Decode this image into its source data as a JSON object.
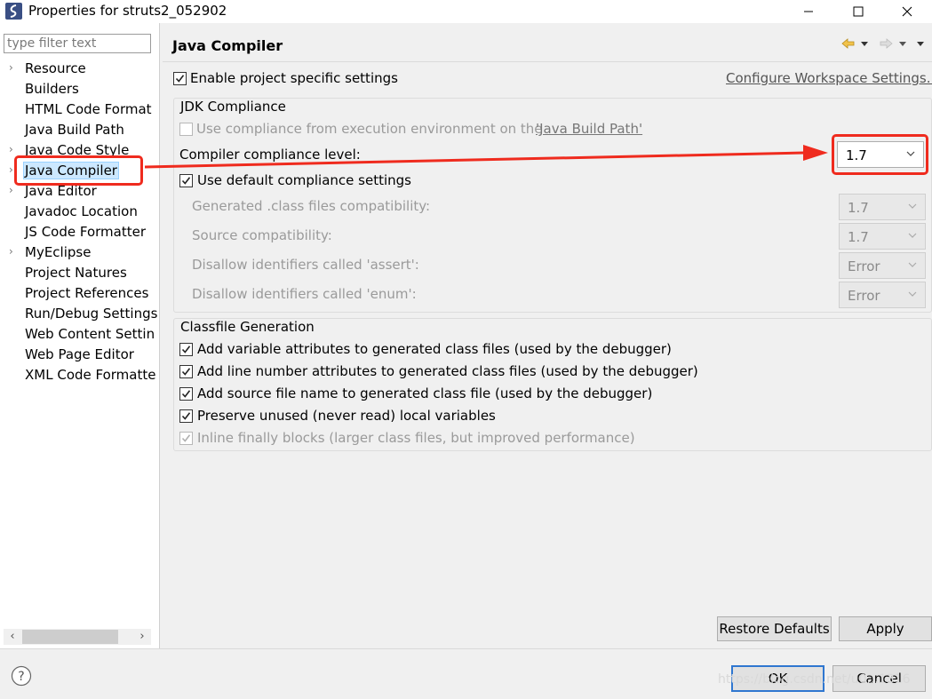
{
  "window": {
    "title": "Properties for struts2_052902"
  },
  "sidebar": {
    "filter_placeholder": "type filter text",
    "items": [
      {
        "label": "Resource",
        "expandable": true
      },
      {
        "label": "Builders",
        "expandable": false
      },
      {
        "label": "HTML Code Format",
        "expandable": false
      },
      {
        "label": "Java Build Path",
        "expandable": false
      },
      {
        "label": "Java Code Style",
        "expandable": true
      },
      {
        "label": "Java Compiler",
        "expandable": true,
        "selected": true
      },
      {
        "label": "Java Editor",
        "expandable": true
      },
      {
        "label": "Javadoc Location",
        "expandable": false
      },
      {
        "label": "JS Code Formatter",
        "expandable": false
      },
      {
        "label": "MyEclipse",
        "expandable": true
      },
      {
        "label": "Project Natures",
        "expandable": false
      },
      {
        "label": "Project References",
        "expandable": false
      },
      {
        "label": "Run/Debug Settings",
        "expandable": false
      },
      {
        "label": "Web Content Settin",
        "expandable": false
      },
      {
        "label": "Web Page Editor",
        "expandable": false
      },
      {
        "label": "XML Code Formatte",
        "expandable": false
      }
    ]
  },
  "main": {
    "title": "Java Compiler",
    "enable_project_settings": {
      "label": "Enable project specific settings",
      "checked": true
    },
    "configure_workspace_link": "Configure Workspace Settings...",
    "jdk": {
      "group_label": "JDK Compliance",
      "use_exec_env": {
        "label": "Use compliance from execution environment on the",
        "checked": false,
        "enabled": false
      },
      "build_path_link": "'Java Build Path'",
      "compliance_level_label": "Compiler compliance level:",
      "compliance_level_value": "1.7",
      "use_default": {
        "label": "Use default compliance settings",
        "checked": true
      },
      "generated_label": "Generated .class files compatibility:",
      "generated_value": "1.7",
      "source_label": "Source compatibility:",
      "source_value": "1.7",
      "assert_label": "Disallow identifiers called 'assert':",
      "assert_value": "Error",
      "enum_label": "Disallow identifiers called 'enum':",
      "enum_value": "Error"
    },
    "classfile": {
      "group_label": "Classfile Generation",
      "options": [
        {
          "label": "Add variable attributes to generated class files (used by the debugger)",
          "checked": true,
          "enabled": true
        },
        {
          "label": "Add line number attributes to generated class files (used by the debugger)",
          "checked": true,
          "enabled": true
        },
        {
          "label": "Add source file name to generated class file (used by the debugger)",
          "checked": true,
          "enabled": true
        },
        {
          "label": "Preserve unused (never read) local variables",
          "checked": true,
          "enabled": true
        },
        {
          "label": "Inline finally blocks (larger class files, but improved performance)",
          "checked": true,
          "enabled": false
        }
      ]
    },
    "restore_defaults_label": "Restore Defaults",
    "apply_label": "Apply"
  },
  "footer": {
    "ok_label": "OK",
    "cancel_label": "Cancel"
  },
  "watermark": "https://blog.csdn.net/u0...1316",
  "colors": {
    "annotation_red": "#ef2b1e",
    "selection_bg": "#cce8ff",
    "ok_border": "#2f77d0"
  }
}
